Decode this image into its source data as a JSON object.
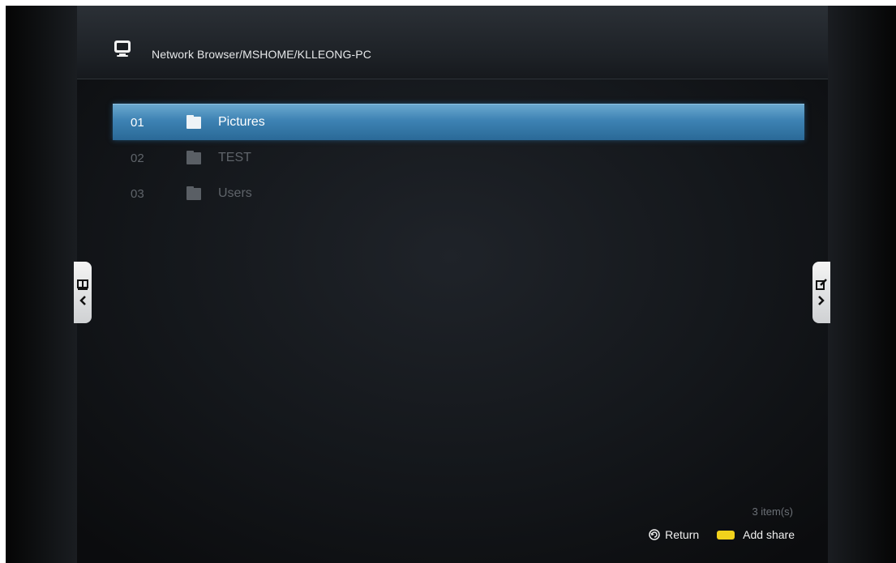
{
  "header": {
    "path": "Network Browser/MSHOME/KLLEONG-PC",
    "icon": "monitor-icon"
  },
  "list": {
    "items": [
      {
        "num": "01",
        "name": "Pictures",
        "icon": "folder-icon",
        "selected": true
      },
      {
        "num": "02",
        "name": "TEST",
        "icon": "folder-icon",
        "selected": false
      },
      {
        "num": "03",
        "name": "Users",
        "icon": "folder-icon",
        "selected": false
      }
    ]
  },
  "footer": {
    "item_count": "3 item(s)",
    "return_label": "Return",
    "add_share_label": "Add share",
    "add_share_key_color": "#f2d21c"
  },
  "tabs": {
    "left_icon": "book-icon",
    "right_icon": "edit-icon"
  },
  "colors": {
    "selection": "#3d82b3",
    "text_dim": "#5f646a",
    "text_bright": "#ffffff"
  }
}
